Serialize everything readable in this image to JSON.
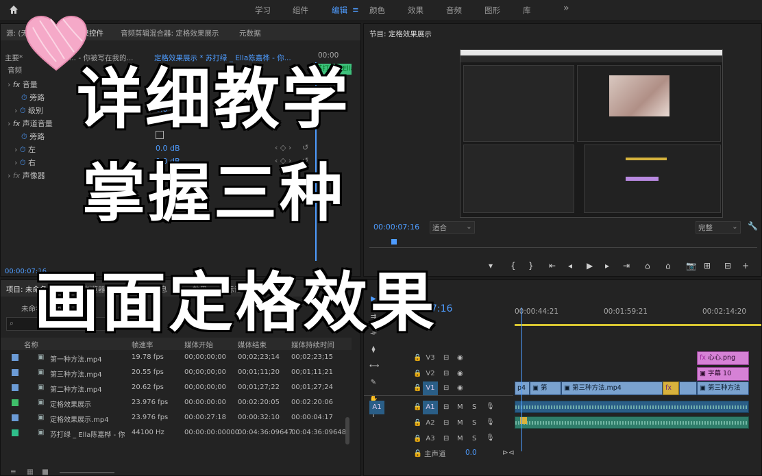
{
  "topbar": {
    "workspaces": [
      "学习",
      "组件",
      "编辑",
      "颜色",
      "效果",
      "音频",
      "图形",
      "库"
    ],
    "active": "编辑",
    "more": "»"
  },
  "source_panel": {
    "tab_source": "源: (无剪辑)",
    "tab_effect_controls": "效果控件",
    "tab_audio_mixer": "音频剪辑混合器: 定格效果展示",
    "tab_metadata": "元数据",
    "master_label": "主要*",
    "master_value": "... - 你被写在我的...",
    "sequence_label": "定格效果展示 * 苏打绿 _ Ella陈嘉桦 - 你...",
    "time_top": "00:00",
    "clip_label": "苏打绿 _ Ella",
    "section_audio": "音频",
    "rows": [
      {
        "indent": 1,
        "fx": true,
        "label": "音量",
        "value": ""
      },
      {
        "indent": 2,
        "label": "旁路",
        "value": ""
      },
      {
        "indent": 2,
        "label": "级别",
        "value": "0.0 dB"
      },
      {
        "indent": 1,
        "fx": true,
        "label": "声道音量",
        "value": ""
      },
      {
        "indent": 2,
        "label": "旁路",
        "value": ""
      },
      {
        "indent": 2,
        "label": "左",
        "value": "0.0 dB"
      },
      {
        "indent": 2,
        "label": "右",
        "value": "0.0 dB"
      },
      {
        "indent": 1,
        "fx": true,
        "label": "声像器",
        "value": ""
      }
    ],
    "timecode": "00:00:07:16"
  },
  "program_panel": {
    "title": "节目: 定格效果展示",
    "timecode": "00:00:07:16",
    "fit": "适合",
    "quality": "完整"
  },
  "project_panel": {
    "tab_project": "项目: 未命名",
    "tab_media": "媒体浏览器",
    "tab_library": "库",
    "tab_info": "信息",
    "tab_effects": "效果",
    "tab_markers": "标记",
    "tab_history": "历史记录",
    "project_name": "未命名.prproj",
    "columns": [
      "名称",
      "帧速率",
      "媒体开始",
      "媒体结束",
      "媒体持续时间"
    ],
    "items": [
      {
        "color": "#6b9bd6",
        "name": "第一种方法.mp4",
        "fps": "19.78 fps",
        "start": "00;00;00;00",
        "end": "00;02;23;14",
        "dur": "00;02;23;15"
      },
      {
        "color": "#6b9bd6",
        "name": "第三种方法.mp4",
        "fps": "20.55 fps",
        "start": "00;00;00;00",
        "end": "00;01;11;20",
        "dur": "00;01;11;21"
      },
      {
        "color": "#6b9bd6",
        "name": "第二种方法.mp4",
        "fps": "20.62 fps",
        "start": "00;00;00;00",
        "end": "00;01;27;22",
        "dur": "00;01;27;24"
      },
      {
        "color": "#3fbf6a",
        "name": "定格效果展示",
        "fps": "23.976 fps",
        "start": "00:00:00:00",
        "end": "00:02:20:05",
        "dur": "00:02:20:06"
      },
      {
        "color": "#6b9bd6",
        "name": "定格效果展示.mp4",
        "fps": "23.976 fps",
        "start": "00:00:27:18",
        "end": "00:00:32:10",
        "dur": "00:00:04:17"
      },
      {
        "color": "#2fbf8a",
        "name": "苏打绿 _ Ella陈嘉桦 - 你",
        "fps": "44100 Hz",
        "start": "00:00:00:00000",
        "end": "00:04:36:09647",
        "dur": "00:04:36:09648"
      }
    ]
  },
  "timeline": {
    "timecode": "00:00:07:16",
    "ruler": [
      "00:00:44:21",
      "00:01:59:21",
      "00:02:14:20"
    ],
    "tracks": [
      {
        "name": "V3",
        "kind": "video"
      },
      {
        "name": "V2",
        "kind": "video"
      },
      {
        "name": "V1",
        "kind": "video",
        "target": true
      },
      {
        "name": "A1",
        "kind": "audio",
        "target": true,
        "src": "A1"
      },
      {
        "name": "A2",
        "kind": "audio"
      },
      {
        "name": "A3",
        "kind": "audio"
      }
    ],
    "master_label": "主声道",
    "master_value": "0.0",
    "clips_v1": [
      "p4",
      "第",
      "第三种方法.mp4",
      "第三种方法"
    ],
    "clips_v3": "心心.png",
    "clips_v2": "字幕 10",
    "mute": "M",
    "solo": "S"
  },
  "overlay": {
    "line1": "详细教学",
    "line2": "掌握三种",
    "line3": "画面定格效果"
  },
  "colors": {
    "accent": "#4e9cff",
    "heart": "#f5a9c8"
  }
}
